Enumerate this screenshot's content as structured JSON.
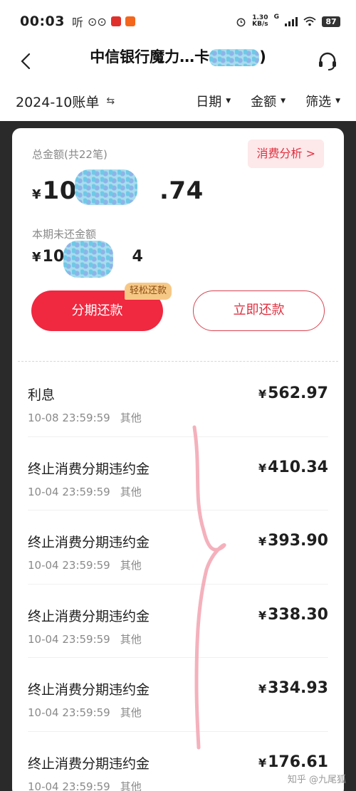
{
  "status_bar": {
    "time": "00:03",
    "left_glyphs": [
      "听",
      "⊙⊙"
    ],
    "net_speed_top": "1.30",
    "net_speed_bottom": "KB/s",
    "signal_type": "G",
    "battery": "87"
  },
  "header": {
    "back_icon": "chevron-left-icon",
    "title_visible_start": "中信银行魔力…卡",
    "title_visible_end": ")",
    "support_icon": "headset-icon"
  },
  "filter_bar": {
    "month": "2024-10账单",
    "swap_icon": "⇆",
    "filters": [
      "日期",
      "金额",
      "筛选"
    ]
  },
  "summary": {
    "total_label": "总金额(共22笔)",
    "analysis_button": "消费分析",
    "analysis_chevron": ">",
    "currency": "¥",
    "total_amount_visible_start": "105",
    "total_amount_visible_end": ".74",
    "unpaid_label": "本期未还金额",
    "unpaid_amount_visible_start": "105",
    "unpaid_amount_visible_end": "4",
    "installment_button": "分期还款",
    "easy_tag": "轻松还款",
    "repay_button": "立即还款"
  },
  "transactions": [
    {
      "title": "利息",
      "time": "10-08 23:59:59",
      "category": "其他",
      "amount": "562.97"
    },
    {
      "title": "终止消费分期违约金",
      "time": "10-04 23:59:59",
      "category": "其他",
      "amount": "410.34"
    },
    {
      "title": "终止消费分期违约金",
      "time": "10-04 23:59:59",
      "category": "其他",
      "amount": "393.90"
    },
    {
      "title": "终止消费分期违约金",
      "time": "10-04 23:59:59",
      "category": "其他",
      "amount": "338.30"
    },
    {
      "title": "终止消费分期违约金",
      "time": "10-04 23:59:59",
      "category": "其他",
      "amount": "334.93"
    },
    {
      "title": "终止消费分期违约金",
      "time": "10-04 23:59:59",
      "category": "其他",
      "amount": "176.61"
    }
  ],
  "watermark": "知乎 @九尾狐",
  "colors": {
    "accent": "#f02840",
    "accent_text": "#e0303f",
    "tag_bg": "#f6c886",
    "dark_band": "#2a2a2a"
  }
}
